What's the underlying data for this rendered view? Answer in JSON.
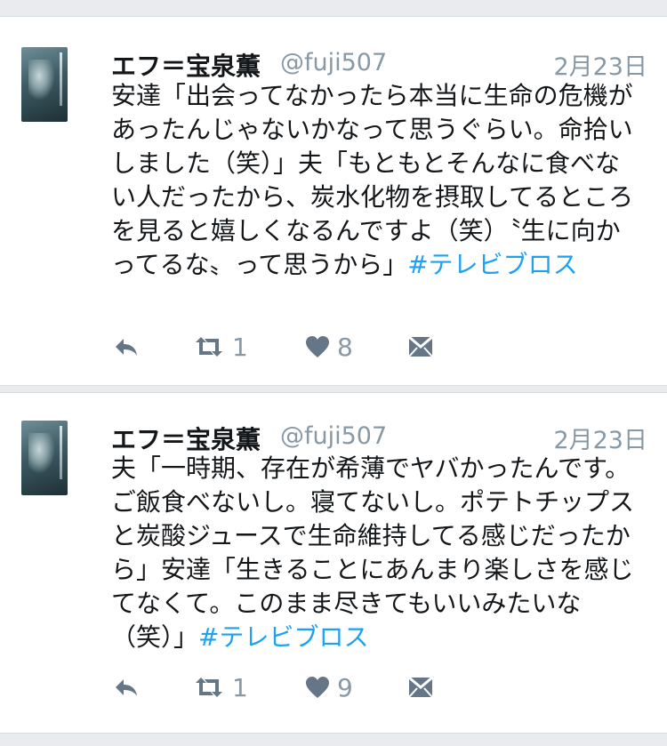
{
  "tweets": [
    {
      "name": "エフ＝宝泉薫",
      "handle": "@fuji507",
      "date": "2月23日",
      "text": "安達「出会ってなかったら本当に生命の危機があったんじゃないかなって思うぐらい。命拾いしました（笑）」夫「もともとそんなに食べない人だったから、炭水化物を摂取してるところを見ると嬉しくなるんですよ（笑）〝生に向かってるな〟って思うから」",
      "hashtag": "#テレビブロス",
      "retweets": "1",
      "likes": "8"
    },
    {
      "name": "エフ＝宝泉薫",
      "handle": "@fuji507",
      "date": "2月23日",
      "text": "夫「一時期、存在が希薄でヤバかったんです。ご飯食べないし。寝てないし。ポテトチップスと炭酸ジュースで生命維持してる感じだったから」安達「生きることにあんまり楽しさを感じてなくて。このまま尽きてもいいみたいな（笑）」",
      "hashtag": "#テレビブロス",
      "retweets": "1",
      "likes": "9"
    }
  ],
  "icons": {
    "reply": "reply-icon",
    "retweet": "retweet-icon",
    "like": "heart-icon",
    "dm": "envelope-icon"
  },
  "colors": {
    "background": "#e9ebee",
    "card": "#ffffff",
    "text": "#14171a",
    "muted": "#8899a6",
    "hashtag": "#1da1f2"
  }
}
